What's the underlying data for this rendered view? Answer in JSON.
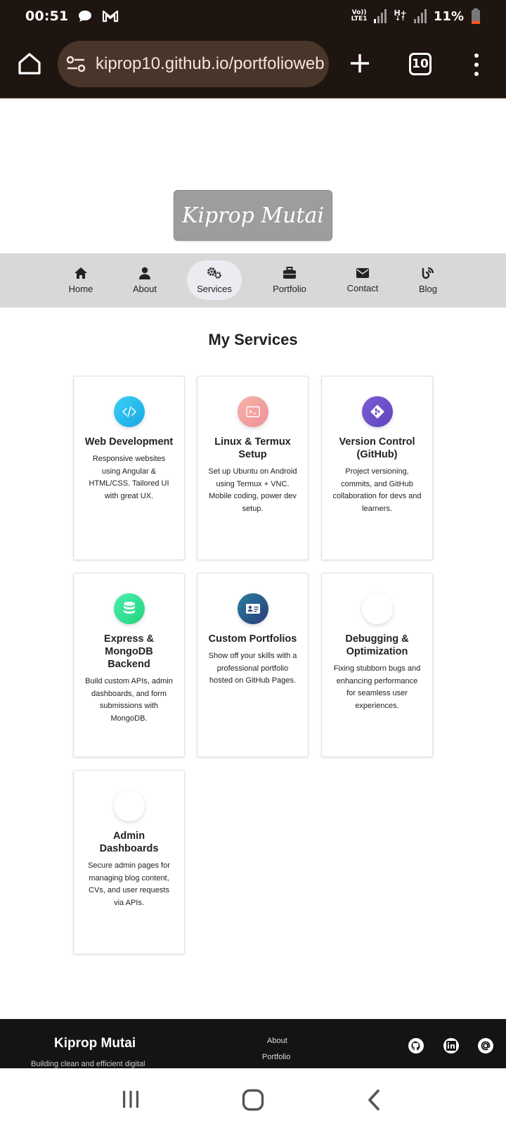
{
  "status_bar": {
    "time": "00:51",
    "network_top": "Vo))",
    "network_bottom": "LTE1",
    "network2_top": "H+",
    "battery": "11%"
  },
  "browser": {
    "url": "kiprop10.github.io/portfolioweb",
    "tab_count": "10"
  },
  "logo": {
    "text": "Kiprop Mutai"
  },
  "nav": {
    "items": [
      {
        "label": "Home",
        "icon": "home-icon"
      },
      {
        "label": "About",
        "icon": "user-icon"
      },
      {
        "label": "Services",
        "icon": "gears-icon"
      },
      {
        "label": "Portfolio",
        "icon": "briefcase-icon"
      },
      {
        "label": "Contact",
        "icon": "envelope-icon"
      },
      {
        "label": "Blog",
        "icon": "blog-icon"
      }
    ],
    "active": "Services"
  },
  "services": {
    "title": "My Services",
    "cards": [
      {
        "title": "Web Development",
        "desc": "Responsive websites using Angular & HTML/CSS. Tailored UI with great UX.",
        "icon": "code-icon",
        "color": "#22b8ec"
      },
      {
        "title": "Linux & Termux Setup",
        "desc": "Set up Ubuntu on Android using Termux + VNC. Mobile coding, power dev setup.",
        "icon": "terminal-icon",
        "color": "#f3a2a2"
      },
      {
        "title": "Version Control (GitHub)",
        "desc": "Project versioning, commits, and GitHub collaboration for devs and learners.",
        "icon": "git-icon",
        "color": "#6b4fc9"
      },
      {
        "title": "Express & MongoDB Backend",
        "desc": "Build custom APIs, admin dashboards, and form submissions with MongoDB.",
        "icon": "database-icon",
        "color": "#35e28f"
      },
      {
        "title": "Custom Portfolios",
        "desc": "Show off your skills with a professional portfolio hosted on GitHub Pages.",
        "icon": "id-card-icon",
        "color": "#2b5a8a"
      },
      {
        "title": "Debugging & Optimization",
        "desc": "Fixing stubborn bugs and enhancing performance for seamless user experiences.",
        "icon": "blank-icon",
        "color": "#ffffff"
      },
      {
        "title": "Admin Dashboards",
        "desc": "Secure admin pages for managing blog content, CVs, and user requests via APIs.",
        "icon": "blank-icon",
        "color": "#ffffff"
      }
    ]
  },
  "footer": {
    "name": "Kiprop Mutai",
    "tagline": "Building clean and efficient digital",
    "links": [
      "About",
      "Portfolio"
    ],
    "social": [
      "github-icon",
      "linkedin-icon",
      "at-icon"
    ]
  }
}
